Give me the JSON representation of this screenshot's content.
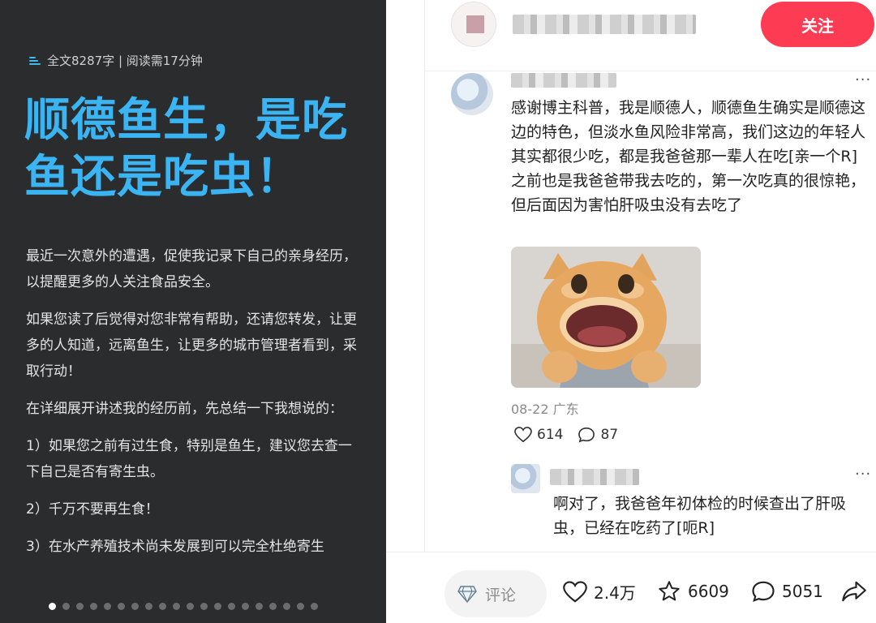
{
  "article": {
    "meta": "全文8287字 | 阅读需17分钟",
    "title": "顺德鱼生，是吃鱼还是吃虫！",
    "paragraphs": [
      "最近一次意外的遭遇，促使我记录下自己的亲身经历，以提醒更多的人关注食品安全。",
      "如果您读了后觉得对您非常有帮助，还请您转发，让更多的人知道，远离鱼生，让更多的城市管理者看到，采取行动！",
      "在详细展开讲述我的经历前，先总结一下我想说的：",
      "1）如果您之前有过生食，特别是鱼生，建议您去查一下自己是否有寄生虫。",
      "2）千万不要再生食！",
      "3）在水产养殖技术尚未发展到可以完全杜绝寄生"
    ],
    "page_total": 20,
    "page_current": 1
  },
  "header": {
    "follow_label": "关注"
  },
  "comments": [
    {
      "text": "感谢博主科普，我是顺德人，顺德鱼生确实是顺德这边的特色，但淡水鱼风险非常高，我们这边的年轻人其实都很少吃，都是我爸爸那一辈人在吃[亲一个R]之前也是我爸爸带我去吃的，第一次吃真的很惊艳，但后面因为害怕肝吸虫没有去吃了",
      "date_location": "08-22 广东",
      "likes": "614",
      "replies": "87",
      "more": "···"
    },
    {
      "text": "啊对了，我爸爸年初体检的时候查出了肝吸虫，已经在吃药了[呃R]",
      "more": "···"
    }
  ],
  "bottom_bar": {
    "comment_placeholder": "评论",
    "likes": "2.4万",
    "collects": "6609",
    "comments": "5051"
  },
  "colors": {
    "title_blue": "#3ab4f2",
    "follow_red": "#fd3b52",
    "dark_bg": "#2b2c2e"
  }
}
